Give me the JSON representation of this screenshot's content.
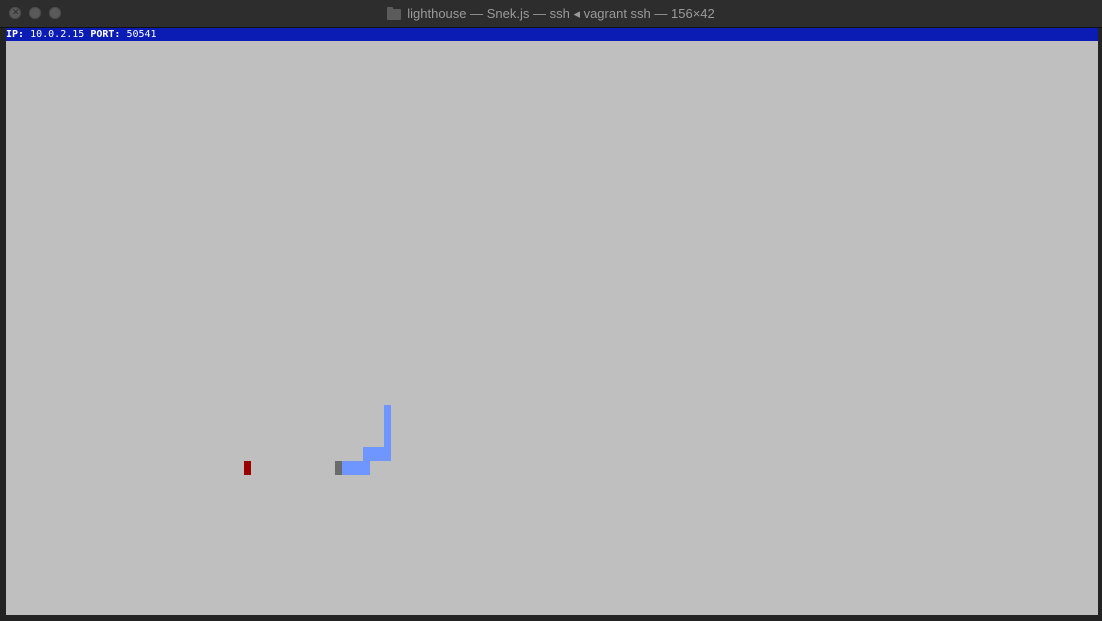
{
  "window": {
    "title": "lighthouse — Snek.js — ssh ◂ vagrant ssh — 156×42",
    "folder_icon": "folder-icon"
  },
  "terminal": {
    "status": {
      "ip_label": "IP:",
      "ip_value": "10.0.2.15",
      "port_label": "PORT:",
      "port_value": "50541"
    },
    "colors": {
      "background": "#bfbfbf",
      "statusbar": "#0a1cb3",
      "food": "#9a0000",
      "snake": "#6f95ff",
      "snake_tail": "#6b6b6b"
    }
  }
}
